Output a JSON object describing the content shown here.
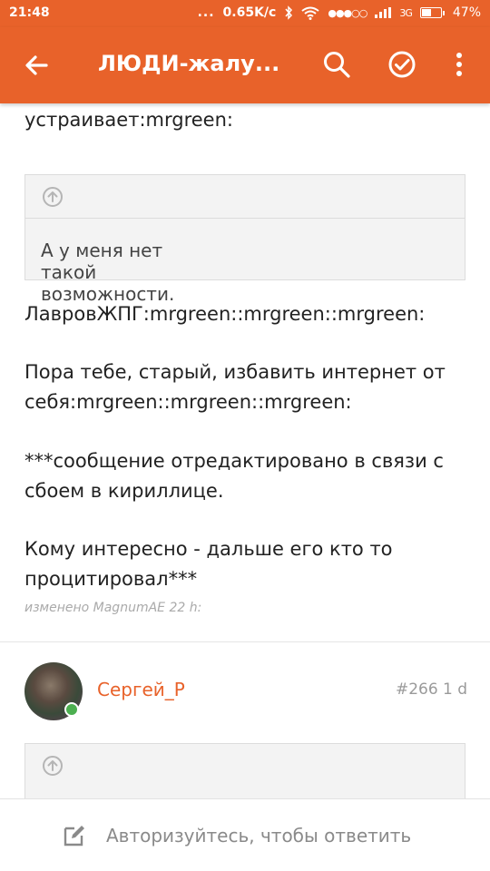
{
  "status_bar": {
    "time": "21:48",
    "dots": "...",
    "speed": "0.65K/c",
    "signal": "●●●○○",
    "network": "3G",
    "battery": "47%",
    "battery_level": 0.47
  },
  "app_bar": {
    "title": "ЛЮДИ-жалу..."
  },
  "post": {
    "top_text": "устраивает:mrgreen:",
    "quote": "А у меня нет такой возможности.",
    "line1": "ЛавровЖПГ:mrgreen::mrgreen::mrgreen:",
    "para1": "Пора тебе, старый, избавить интернет от себя:mrgreen::mrgreen::mrgreen:",
    "para2": "***сообщение отредактировано в связи с сбоем в кириллице.",
    "para3": "Кому интересно - дальше его кто то процитировал***",
    "edited": "изменено MagnumAE 22 h:"
  },
  "next_post": {
    "author": "Сергей_Р",
    "number": "#266",
    "age": "1 d"
  },
  "bottom_bar": {
    "reply_label": "Авторизуйтесь, чтобы ответить"
  },
  "colors": {
    "accent": "#e8622a",
    "online": "#4caf50"
  },
  "icons": [
    "arrow-back-icon",
    "search-icon",
    "check-circle-icon",
    "more-vert-icon",
    "arrow-up-circle-icon",
    "edit-icon"
  ]
}
